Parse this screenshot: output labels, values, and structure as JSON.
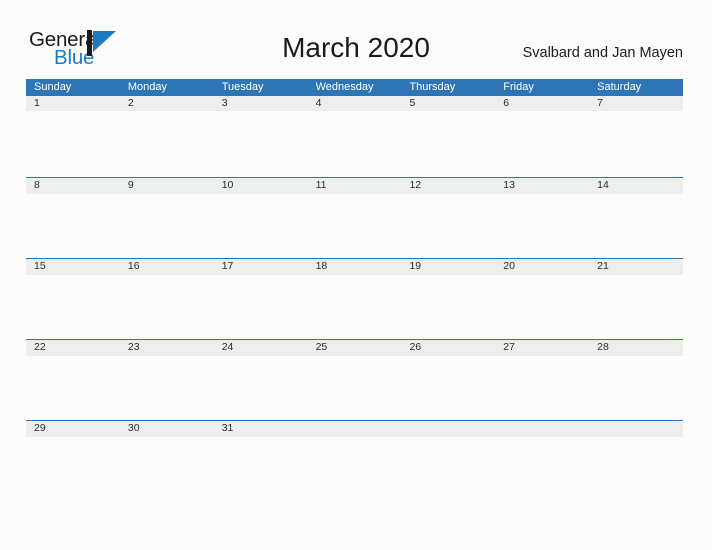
{
  "brand": {
    "name_part1": "General",
    "name_part2": "Blue",
    "flag_color": "#1c7ac0",
    "text_color": "#1b1b1b"
  },
  "header": {
    "title": "March 2020",
    "region": "Svalbard and Jan Mayen"
  },
  "calendar": {
    "accent_color": "#2e75b6",
    "band_color": "#eeeeee",
    "weekdays": [
      "Sunday",
      "Monday",
      "Tuesday",
      "Wednesday",
      "Thursday",
      "Friday",
      "Saturday"
    ],
    "weeks": [
      [
        "1",
        "2",
        "3",
        "4",
        "5",
        "6",
        "7"
      ],
      [
        "8",
        "9",
        "10",
        "11",
        "12",
        "13",
        "14"
      ],
      [
        "15",
        "16",
        "17",
        "18",
        "19",
        "20",
        "21"
      ],
      [
        "22",
        "23",
        "24",
        "25",
        "26",
        "27",
        "28"
      ],
      [
        "29",
        "30",
        "31",
        "",
        "",
        "",
        ""
      ]
    ]
  }
}
